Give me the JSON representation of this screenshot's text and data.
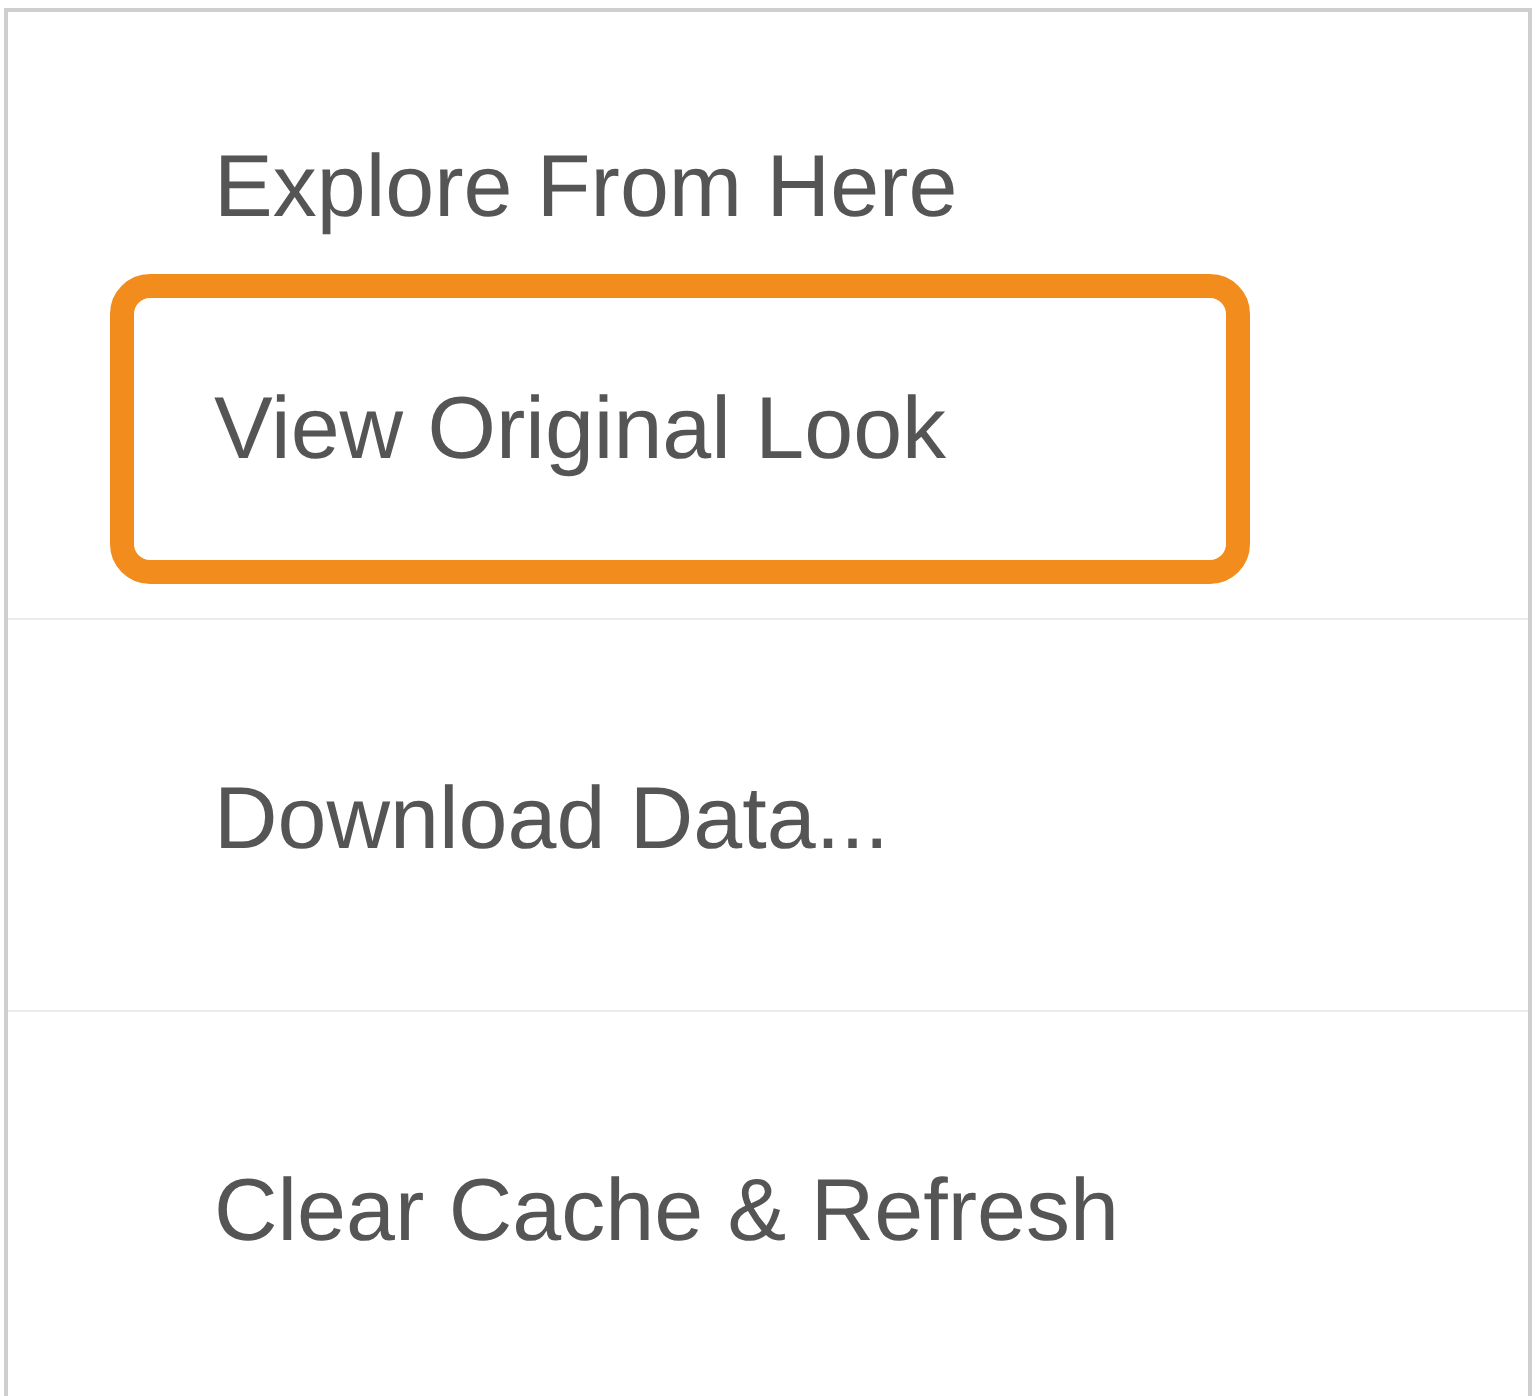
{
  "menu": {
    "groups": [
      {
        "items": [
          {
            "label": "Explore From Here",
            "highlighted": false
          },
          {
            "label": "View Original Look",
            "highlighted": true
          }
        ]
      },
      {
        "items": [
          {
            "label": "Download Data...",
            "highlighted": false
          }
        ]
      },
      {
        "items": [
          {
            "label": "Clear Cache & Refresh",
            "highlighted": false
          }
        ]
      }
    ]
  }
}
